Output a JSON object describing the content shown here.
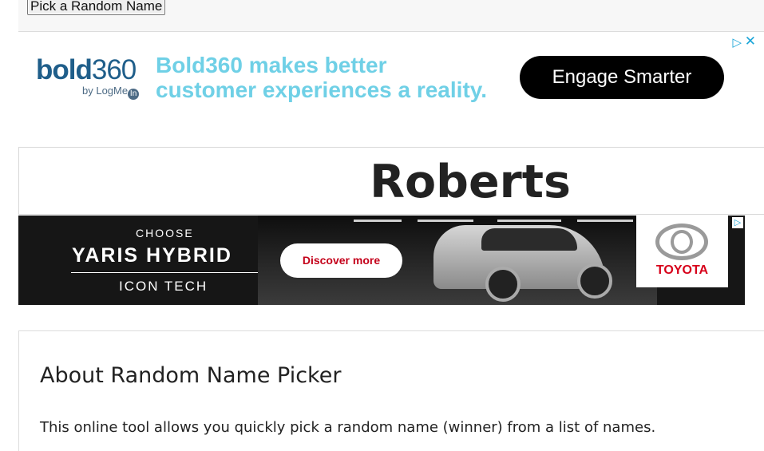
{
  "controls": {
    "pick_button_label": "Pick a Random Name"
  },
  "ad_top": {
    "brand": "bold",
    "brand_num": "360",
    "byline": "by LogMe",
    "byline_in": "In",
    "headline_1": "Bold360 makes better",
    "headline_2": "customer experiences a reality.",
    "cta": "Engage Smarter",
    "adchoices_icon": "▷",
    "close_icon": "✕"
  },
  "result": {
    "name": "Roberts"
  },
  "ad_car": {
    "choose": "CHOOSE",
    "model": "YARIS HYBRID",
    "trim": "ICON TECH",
    "cta": "Discover more",
    "brand": "TOYOTA",
    "adchoices_icon": "▷"
  },
  "about": {
    "title": "About Random Name Picker",
    "text": "This online tool allows you quickly pick a random name (winner) from a list of names."
  },
  "colors": {
    "accent_cyan": "#6fd0e6",
    "brand_blue": "#1f5e8a",
    "toyota_red": "#d7001a"
  }
}
